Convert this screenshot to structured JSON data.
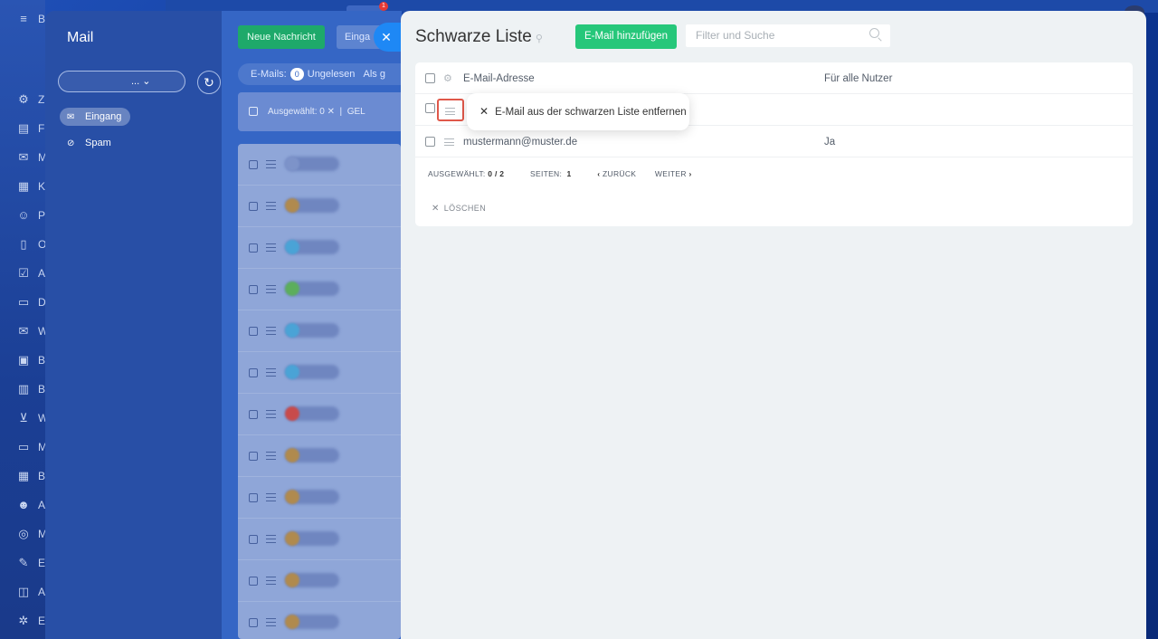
{
  "colors": {
    "accent_green": "#26c77a",
    "close_blue": "#1e88f5",
    "highlight_red": "#e0584a",
    "panel_bg": "#eef2f4"
  },
  "leftnav": {
    "items": [
      {
        "icon": "puzzle-icon",
        "letter": "Z"
      },
      {
        "icon": "document-icon",
        "letter": "F"
      },
      {
        "icon": "chat-icon",
        "letter": "M"
      },
      {
        "icon": "calendar-icon",
        "letter": "K"
      },
      {
        "icon": "contacts-icon",
        "letter": "P"
      },
      {
        "icon": "file-icon",
        "letter": "O"
      },
      {
        "icon": "tasks-icon",
        "letter": "A"
      },
      {
        "icon": "drive-icon",
        "letter": "D"
      },
      {
        "icon": "mail-icon",
        "letter": "W"
      },
      {
        "icon": "board-icon",
        "letter": "B"
      },
      {
        "icon": "analytics-icon",
        "letter": "B"
      },
      {
        "icon": "cart-icon",
        "letter": "W"
      },
      {
        "icon": "monitor-icon",
        "letter": "M"
      },
      {
        "icon": "schedule-icon",
        "letter": "B"
      },
      {
        "icon": "robot-icon",
        "letter": "A"
      },
      {
        "icon": "marketing-icon",
        "letter": "M"
      },
      {
        "icon": "edit-icon",
        "letter": "E"
      },
      {
        "icon": "apps-icon",
        "letter": "A"
      },
      {
        "icon": "settings-icon",
        "letter": "E"
      }
    ],
    "header_letter": "B"
  },
  "mail": {
    "title": "Mail",
    "selector_suffix": "...",
    "folders": [
      {
        "label": "Eingang"
      },
      {
        "label": "Spam"
      }
    ],
    "new_button": "Neue Nachricht",
    "inbox_button": "Einga",
    "stats_label": "E-Mails:",
    "stats_count": "0",
    "stats_unread": "Ungelesen",
    "stats_more": "Als g",
    "selected_label": "Ausgewählt: 0",
    "selected_action": "GEL"
  },
  "blacklist": {
    "title": "Schwarze Liste",
    "add_button": "E-Mail hinzufügen",
    "search_placeholder": "Filter und Suche",
    "header": {
      "col_email": "E-Mail-Adresse",
      "col_all_users": "Für alle Nutzer"
    },
    "rows": [
      {
        "email": "",
        "all_users": ""
      },
      {
        "email": "mustermann@muster.de",
        "all_users": "Ja"
      }
    ],
    "popup_action": "E-Mail aus der schwarzen Liste entfernen",
    "footer": {
      "selected_label": "AUSGEWÄHLT:",
      "selected_value": "0 / 2",
      "pages_label": "SEITEN:",
      "pages_value": "1",
      "back": "ZURÜCK",
      "next": "WEITER"
    },
    "delete_label": "LÖSCHEN"
  }
}
